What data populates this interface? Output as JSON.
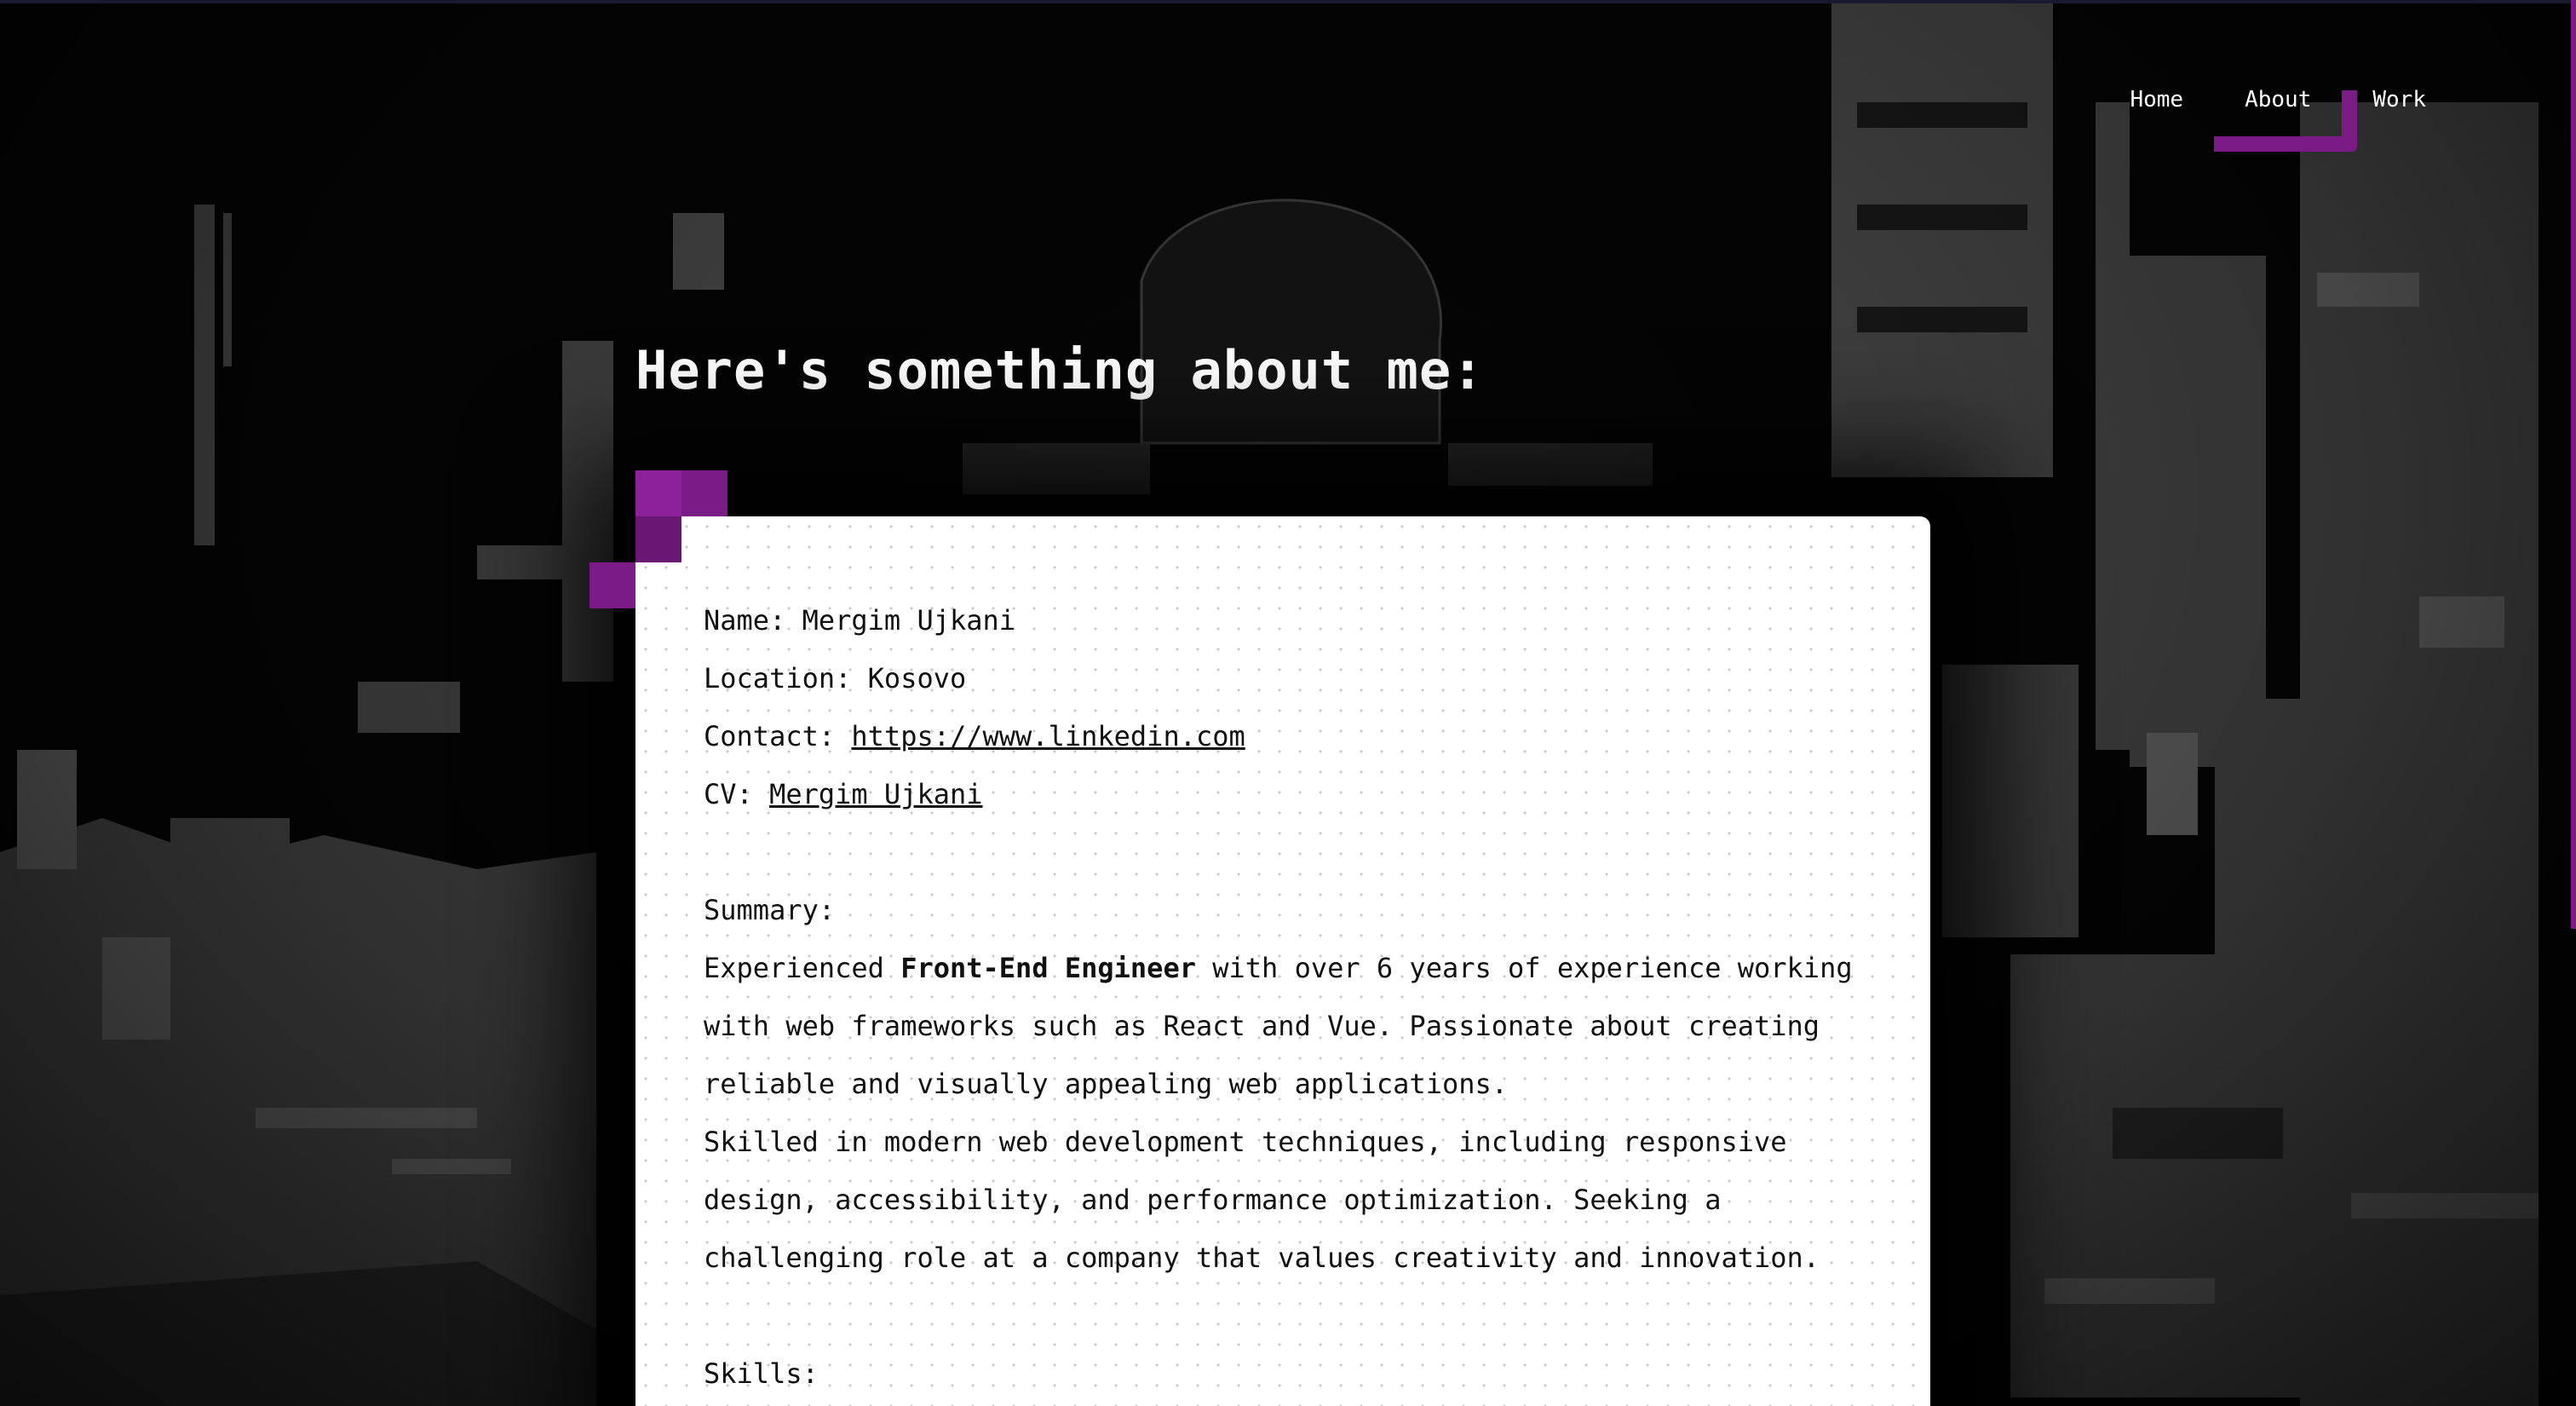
{
  "nav": {
    "items": [
      {
        "label": "Home",
        "active": false
      },
      {
        "label": "About",
        "active": true
      },
      {
        "label": "Work",
        "active": false
      }
    ]
  },
  "heading": "Here's something about me:",
  "profile": {
    "name_label": "Name:",
    "name_value": "Mergim Ujkani",
    "location_label": "Location:",
    "location_value": "Kosovo",
    "contact_label": "Contact:",
    "contact_link": "https://www.linkedin.com",
    "cv_label": "CV:",
    "cv_link": "Mergim Ujkani"
  },
  "summary": {
    "label": "Summary:",
    "p1_before": "Experienced ",
    "p1_bold": "Front-End Engineer",
    "p1_after": " with over 6 years of experience working with web frameworks such as React and Vue. Passionate about creating reliable and visually appealing web applications.",
    "p2": "Skilled in modern web development techniques, including responsive design, accessibility, and performance optimization. Seeking a challenging role at a company that values creativity and innovation."
  },
  "skills": {
    "label": "Skills:"
  },
  "colors": {
    "accent": "#7b1b86",
    "background": "#000000",
    "card": "#ffffff",
    "text": "#111111"
  }
}
